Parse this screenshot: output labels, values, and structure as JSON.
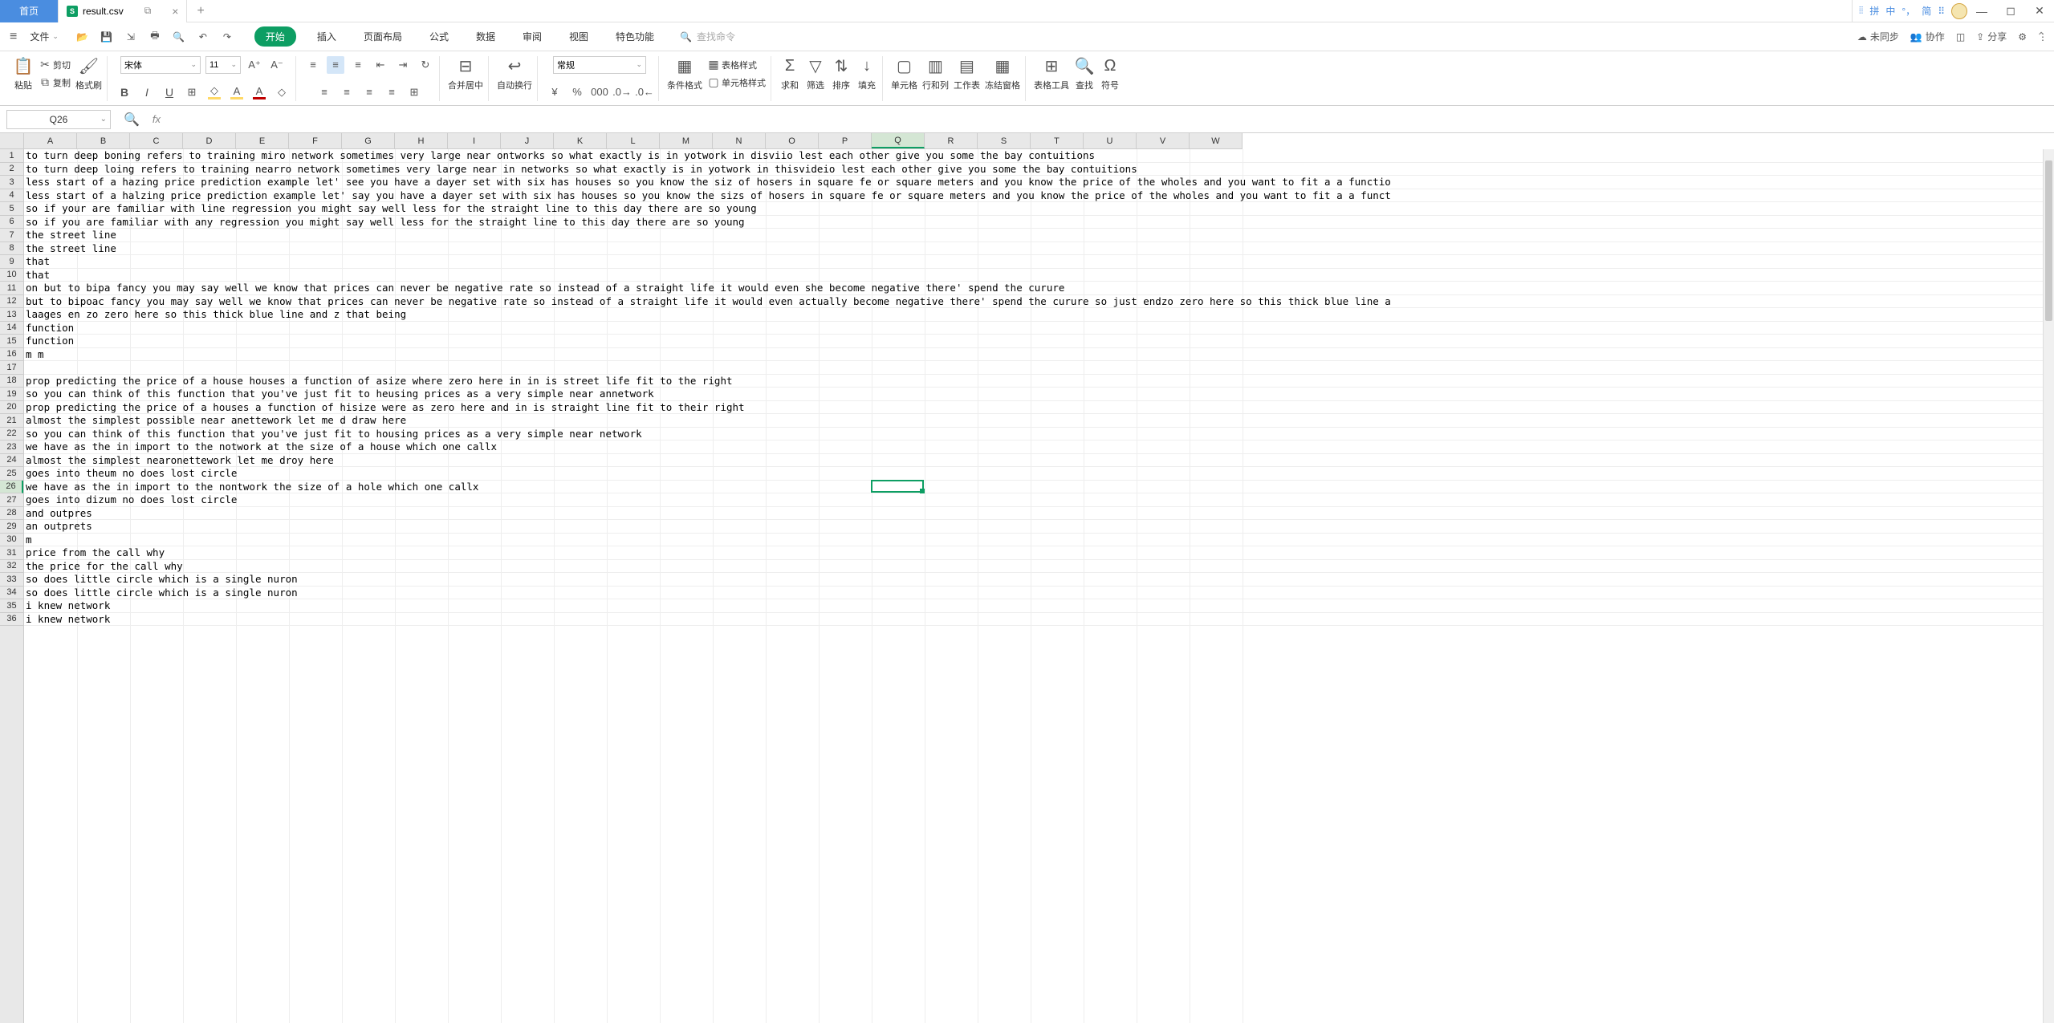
{
  "titlebar": {
    "home_tab": "首页",
    "file_tab": "result.csv",
    "ime": {
      "pin": "拼",
      "zhong": "中",
      "jian": "简"
    }
  },
  "menubar": {
    "file": "文件",
    "tabs": [
      "开始",
      "插入",
      "页面布局",
      "公式",
      "数据",
      "审阅",
      "视图",
      "特色功能"
    ],
    "search_placeholder": "查找命令",
    "right": {
      "sync": "未同步",
      "coop": "协作",
      "share": "分享"
    }
  },
  "ribbon": {
    "paste": "粘贴",
    "cut": "剪切",
    "copy": "复制",
    "format_painter": "格式刷",
    "font_name": "宋体",
    "font_size": "11",
    "merge": "合并居中",
    "wrap": "自动换行",
    "number_format": "常规",
    "cond_fmt": "条件格式",
    "table_style": "表格样式",
    "cell_style": "单元格样式",
    "sum": "求和",
    "filter": "筛选",
    "sort": "排序",
    "fill": "填充",
    "cell": "单元格",
    "row_col": "行和列",
    "sheet": "工作表",
    "freeze": "冻结窗格",
    "tools": "表格工具",
    "find": "查找",
    "symbol": "符号"
  },
  "fx": {
    "cell_ref": "Q26"
  },
  "columns": [
    "A",
    "B",
    "C",
    "D",
    "E",
    "F",
    "G",
    "H",
    "I",
    "J",
    "K",
    "L",
    "M",
    "N",
    "O",
    "P",
    "Q",
    "R",
    "S",
    "T",
    "U",
    "V",
    "W"
  ],
  "sel_col": "Q",
  "sel_row": 26,
  "rows": [
    "to turn deep boning refers to training miro network sometimes very large near ontworks so what exactly is in yotwork in disviio lest each other give you some the bay contuitions",
    "to turn deep loing refers to training nearro network sometimes very large near in networks so what exactly is in yotwork in thisvideio lest each other give you some the bay contuitions",
    "less start of a hazing price prediction example let' see you have a dayer set with six has houses so you know the siz of hosers in square fe or square meters and you know the price of the wholes and you want to fit a a functio",
    "less start of a halzing price prediction example let' say you have a dayer set with six has houses so you know the sizs of hosers in square fe or square meters and you know the price of the wholes and you want to fit a a funct",
    "so if your are familiar with line regression you might say well less for the straight line to this day there are so young",
    "so if you are familiar with any regression you might say well less for the straight line to this day there are so young",
    "the street line",
    "the street line",
    "that",
    "that",
    "on but to bipa fancy you may say well we know that prices can never be negative rate so instead of a straight life it would even she become negative there' spend the curure",
    "but to bipoac fancy you may say well we know that prices can never be negative rate so instead of a straight life it would even actually become negative there' spend the curure so just endzo zero here so this thick blue line a",
    "laages en zo zero here so this thick blue line and z that being",
    "function",
    "function",
    "m m",
    "",
    "prop predicting the price of a house houses a function of asize where zero here in in is street life fit to the right",
    "so you can think of this function that you've just fit to heusing prices as a very simple near annetwork",
    "prop predicting the price of a houses a function of hisize were as zero here and in is straight line fit to their right",
    "almost the simplest possible near anettework let me d draw here",
    "so you can think of this function that you've just fit to housing prices as a very simple near network",
    "we have as the in import to the notwork at the size of a house which one callx",
    "almost the simplest nearonettework let me droy here",
    "goes into theum no does lost circle",
    "we have as the in import to the nontwork the size of a hole which one callx",
    "goes into dizum no does lost circle",
    "and outpres",
    "an outprets",
    "m",
    "price from the call why",
    "the price for the call why",
    "so does little circle which is a single nuron",
    "so does little circle which is a single nuron",
    "i knew network",
    "i knew network"
  ]
}
